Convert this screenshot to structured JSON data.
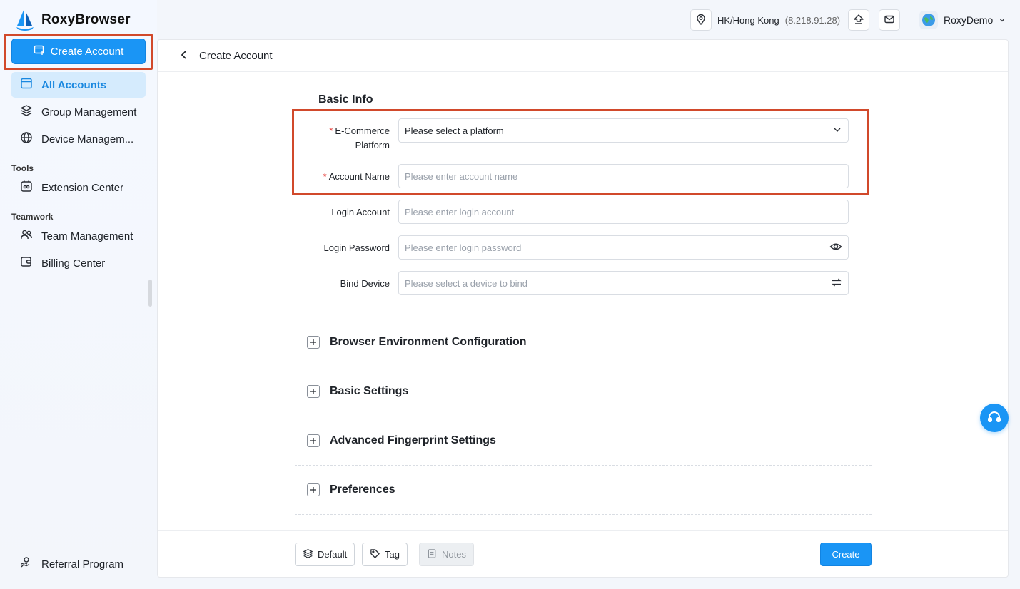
{
  "app": {
    "brand": "RoxyBrowser"
  },
  "sidebar": {
    "create_button": "Create Account",
    "items": [
      {
        "label": "All Accounts",
        "icon": "accounts-icon",
        "active": true
      },
      {
        "label": "Group Management",
        "icon": "layers-icon"
      },
      {
        "label": "Device Managem...",
        "icon": "globe-icon"
      }
    ],
    "tools_heading": "Tools",
    "tools_items": [
      {
        "label": "Extension Center",
        "icon": "extension-icon"
      }
    ],
    "teamwork_heading": "Teamwork",
    "teamwork_items": [
      {
        "label": "Team Management",
        "icon": "team-icon"
      },
      {
        "label": "Billing Center",
        "icon": "wallet-icon"
      }
    ],
    "bottom_item": {
      "label": "Referral Program",
      "icon": "referral-icon"
    }
  },
  "topbar": {
    "location": "HK/Hong Kong",
    "ip": "(8.218.91.28)",
    "user": "RoxyDemo"
  },
  "page": {
    "title": "Create Account",
    "basic_info_title": "Basic Info",
    "fields": {
      "platform": {
        "label_line1": "E-Commerce",
        "label_line2": "Platform",
        "value": "Please select a platform",
        "required": true
      },
      "account_name": {
        "label": "Account Name",
        "placeholder": "Please enter account name",
        "required": true
      },
      "login_account": {
        "label": "Login Account",
        "placeholder": "Please enter login account"
      },
      "login_password": {
        "label": "Login Password",
        "placeholder": "Please enter login password"
      },
      "bind_device": {
        "label": "Bind Device",
        "placeholder": "Please select a device to bind"
      }
    },
    "sections": [
      "Browser Environment Configuration",
      "Basic Settings",
      "Advanced Fingerprint Settings",
      "Preferences"
    ],
    "footer": {
      "default_label": "Default",
      "tag_label": "Tag",
      "notes_label": "Notes",
      "create_label": "Create"
    }
  },
  "colors": {
    "accent": "#1a95f5",
    "highlight_border": "#d1492b",
    "active_nav_bg": "#d5ebfd"
  }
}
